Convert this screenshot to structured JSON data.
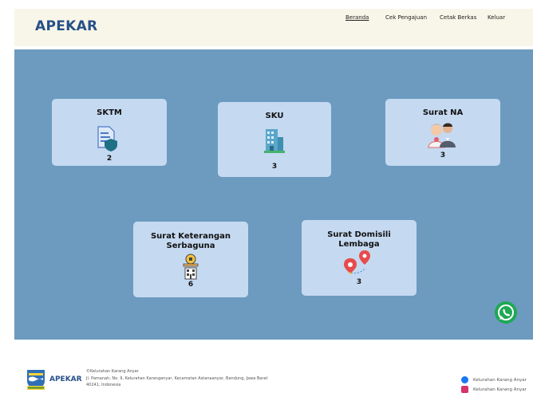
{
  "header": {
    "brand": "APEKAR",
    "nav": [
      {
        "label": "Beranda",
        "active": true
      },
      {
        "label": "Cek Pengajuan",
        "active": false
      },
      {
        "label": "Cetak Berkas",
        "active": false
      },
      {
        "label": "Keluar",
        "active": false
      }
    ]
  },
  "cards": [
    {
      "title": "SKTM",
      "count": "2",
      "icon": "document-shield-icon"
    },
    {
      "title": "SKU",
      "count": "3",
      "icon": "building-icon"
    },
    {
      "title": "Surat NA",
      "count": "3",
      "icon": "couple-icon"
    },
    {
      "title_line1": "Surat Keterangan",
      "title_line2": "Serbaguna",
      "count": "6",
      "icon": "hand-building-icon"
    },
    {
      "title_line1": "Surat Domisili",
      "title_line2": "Lembaga",
      "count": "3",
      "icon": "location-pins-icon"
    }
  ],
  "footer": {
    "brand": "APEKAR",
    "line1": "©Kelurahan Karang Anyar",
    "line2": "Jl. Pamanah, No. 9, Kelurahan Karanganyar, Kecamatan Astanaanyar, Bandung, Jawa Barat",
    "line3": "40241, Indonesia",
    "social": [
      {
        "label": "Kelurahan Karang Anyar",
        "icon": "facebook-icon"
      },
      {
        "label": "Kelurahan Karang Anyar",
        "icon": "instagram-icon"
      }
    ]
  },
  "colors": {
    "brand": "#27508a",
    "header_bg": "#f8f6e8",
    "panel_bg": "#6c9bbf",
    "card_bg": "#c5d9f1",
    "whatsapp": "#1fa855"
  }
}
